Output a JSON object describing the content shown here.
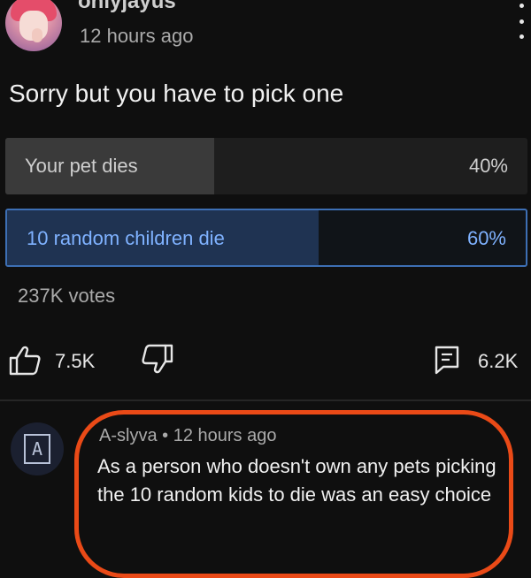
{
  "post": {
    "channel_name": "onlyjayus",
    "time_ago": "12 hours ago",
    "text": "Sorry but you have to pick one"
  },
  "poll": {
    "options": [
      {
        "label": "Your pet dies",
        "percent": "40%",
        "fraction": 0.4,
        "selected": false
      },
      {
        "label": "10 random children die",
        "percent": "60%",
        "fraction": 0.6,
        "selected": true
      }
    ],
    "votes": "237K votes"
  },
  "actions": {
    "likes": "7.5K",
    "comments": "6.2K",
    "like_icon": "thumbs-up-icon",
    "dislike_icon": "thumbs-down-icon",
    "comment_icon": "comment-icon",
    "more_icon": "more-vertical-icon"
  },
  "comment": {
    "avatar_letter": "A",
    "author": "A-slyva",
    "separator": "•",
    "time_ago": "12 hours ago",
    "text": "As a person who doesn't own any pets picking the 10 random kids to die was an easy choice"
  },
  "colors": {
    "background": "#0f0f0f",
    "selected_accent": "#3d6fb4",
    "highlight_annotation": "#ea4a17"
  }
}
